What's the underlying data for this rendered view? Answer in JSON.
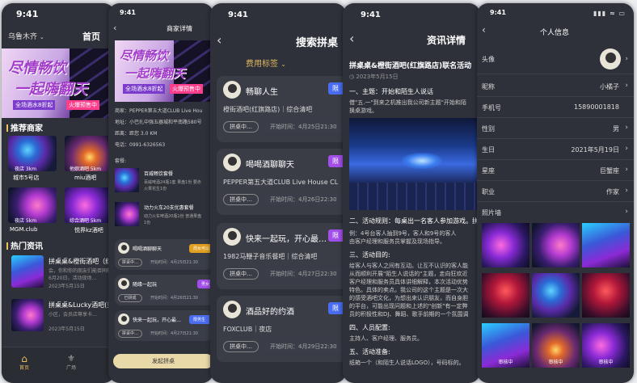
{
  "phone1": {
    "city": "乌鲁木齐",
    "title": "首页",
    "banner_title_1": "尽情畅饮",
    "banner_title_2": "一起嗨翻天",
    "banner_tag": "全场酒水8折起",
    "banner_tag2": "火爆预售中",
    "section_merchants": "推荐商家",
    "merchants": [
      {
        "name": "城市5号店",
        "distance": "夜店 3km"
      },
      {
        "name": "miu酒吧",
        "distance": "他娘酒吧 5km"
      },
      {
        "name": "MGM.club",
        "distance": "夜店 5km"
      },
      {
        "name": "悦界kz酒吧",
        "distance": "综合酒吧 5km"
      }
    ],
    "section_news": "热门资讯",
    "news": [
      {
        "title": "拼桌桌&橙街酒吧（红",
        "sub": "会，你和你的朋友们能否同样",
        "sub2": "6月20日，活动现场…",
        "date": "2023年5月15日"
      },
      {
        "title": "拼桌桌&Lucky酒吧(贝",
        "sub": "小区，会员店尊享卡…",
        "sub2": "",
        "date": "2023年5月15日"
      }
    ],
    "tabs": [
      {
        "label": "首页"
      },
      {
        "label": "广场"
      }
    ]
  },
  "phone2": {
    "time": "9:41",
    "title": "商家详情",
    "banner_title_1": "尽情畅饮",
    "banner_title_2": "一起嗨翻天",
    "banner_tag": "全场酒水8折起",
    "banner_tag2": "火爆预售中",
    "merchant_line": "商家：PEPPER第五大道CLUB Live Hou",
    "address_line": "地址：小巴扎中强五器城和平南路580号",
    "distance_line": "距离：距您 3.0 KM",
    "phone_line": "电话：0991-6326563",
    "section_packages": "套餐:",
    "packages": [
      {
        "name": "百威畅饮套餐",
        "desc": "百威啤酒24瓶1套 果盘1份 要赤",
        "desc2": "火果花生1份"
      },
      {
        "name": "动力火车20支优惠套餐",
        "desc": "动力火车啤酒20瓶1份 普通果盘",
        "desc2": "1份"
      }
    ],
    "posts": [
      {
        "user": "喝喝酒聊聊天",
        "badge": "周女可以",
        "btn": "拼桌中…",
        "time": "开始时间：4月25日21:30"
      },
      {
        "user": "随缘一起玩",
        "badge": "男女",
        "btn": "已拼成",
        "time": "开始时间：4月26日21:30"
      },
      {
        "user": "快来一起玩，开心最…",
        "badge": "限男生",
        "btn": "拼桌中…",
        "time": "开始时间：4月27日21:30"
      }
    ],
    "cta": "发起拼桌"
  },
  "phone3": {
    "time": "9:41",
    "title": "搜索拼桌",
    "filter": "费用标签",
    "cards": [
      {
        "user": "畅聊人生",
        "venue": "橙街酒吧(红旗路店)｜综合清吧",
        "btn": "拼桌中…",
        "time": "开始时间：4月25日21:30",
        "badge": "限",
        "badge_color": "#4a6cf0"
      },
      {
        "user": "喝喝酒聊聊天",
        "venue": "PEPPER第五大道CLUB Live House CL",
        "btn": "拼桌中…",
        "time": "开始时间：4月26日22:30",
        "badge": "限",
        "badge_color": "#a24ee8"
      },
      {
        "user": "快来一起玩，开心最…",
        "venue": "1982马鞭子音乐餐吧｜综合清吧",
        "btn": "拼桌中…",
        "time": "开始时间：4月27日22:30",
        "badge": "限",
        "badge_color": "#a24ee8"
      },
      {
        "user": "酒品好的约酒",
        "venue": "FOXCLUB｜夜店",
        "btn": "拼桌中…",
        "time": "开始时间：4月29日22:30",
        "badge": "限",
        "badge_color": "#4a6cf0"
      }
    ]
  },
  "phone4": {
    "time": "9:41",
    "title": "资讯详情",
    "headline": "拼桌桌&橙街酒吧(红旗路店)联名活动",
    "date": "2023年5月15日",
    "p1_title": "一、主题：开始和陌生人说话",
    "p1_1": "借\"五.一\"到来之机推出我公司新主题\"开始和陌",
    "p1_2": "换桌游戏。",
    "p2_title": "二、活动规则：每桌出一名客人参加游戏。拼",
    "p2_1": "例：4号台客人抽到9号，客人和9号的客人",
    "p2_2": "由客户经理和服务员掌握及现场指导。",
    "p3_title": "三、活动目的:",
    "p3_lines": [
      "给客人与客人之间有互动。让互不认识的客人能",
      "从而顺利开展\"陌生人说话的\"主题，走向狂欢近",
      "客户经理和服务员具体讲细解释，本次活动优势",
      "特色。具体的卖点。我公司的这个主题是一次大",
      "的感受酒吧文化，为想出来认识朋友，而自身胆",
      "的平台，可能出现问题和上述的\"创新\"有一定弊",
      "员的积极性和DJ、舞蹈、歌手前期的一个氛围调"
    ],
    "p4_title": "四、人员配置:",
    "p4_1": "主持人、客户经理、服务员。",
    "p5_title": "五、活动准备:",
    "p5_1": "纸箱一个（和陌生人说话LOGO），号码标的。"
  },
  "phone5": {
    "time": "9:41",
    "title": "个人信息",
    "rows": [
      {
        "label": "头像",
        "value": ""
      },
      {
        "label": "昵称",
        "value": "小橘子"
      },
      {
        "label": "手机号",
        "value": "15890001818"
      },
      {
        "label": "性别",
        "value": "男"
      },
      {
        "label": "生日",
        "value": "2021年5月19日"
      },
      {
        "label": "星座",
        "value": "巨蟹座"
      },
      {
        "label": "职业",
        "value": "作家"
      },
      {
        "label": "照片墙",
        "value": ""
      }
    ],
    "photo_captions": [
      "",
      "",
      "",
      "",
      "",
      "",
      "",
      "",
      "",
      "审核中",
      "审核中",
      "审核中"
    ]
  }
}
